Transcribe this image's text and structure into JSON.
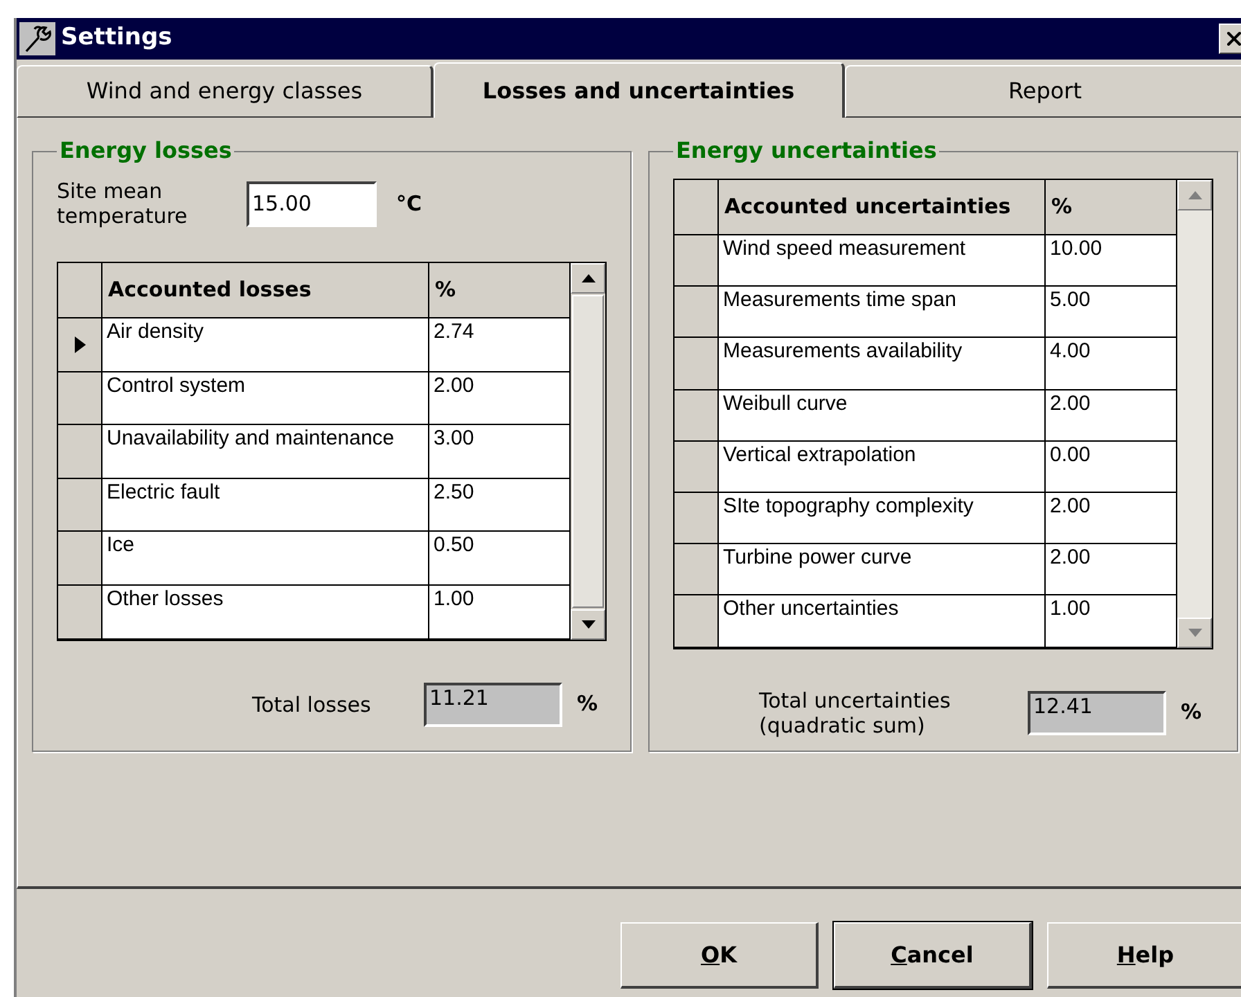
{
  "window": {
    "title": "Settings"
  },
  "tabs": [
    {
      "label": "Wind and energy classes",
      "selected": false
    },
    {
      "label": "Losses and uncertainties",
      "selected": true
    },
    {
      "label": "Report",
      "selected": false
    }
  ],
  "energy_losses": {
    "title": "Energy losses",
    "temperature": {
      "label": "Site mean temperature",
      "value": "15.00",
      "unit": "°C"
    },
    "table": {
      "columns": [
        "Accounted losses",
        "%"
      ],
      "rows": [
        {
          "name": "Air density",
          "value": "2.74",
          "selected": true
        },
        {
          "name": "Control system",
          "value": "2.00",
          "selected": false
        },
        {
          "name": "Unavailability and maintenance",
          "value": "3.00",
          "selected": false
        },
        {
          "name": "Electric fault",
          "value": "2.50",
          "selected": false
        },
        {
          "name": "Ice",
          "value": "0.50",
          "selected": false
        },
        {
          "name": "Other losses",
          "value": "1.00",
          "selected": false
        }
      ]
    },
    "total": {
      "label": "Total losses",
      "value": "11.21",
      "unit": "%"
    }
  },
  "energy_uncertainties": {
    "title": "Energy uncertainties",
    "table": {
      "columns": [
        "Accounted uncertainties",
        "%"
      ],
      "rows": [
        {
          "name": "Wind speed measurement",
          "value": "10.00",
          "selected": false
        },
        {
          "name": "Measurements time span",
          "value": "5.00",
          "selected": false
        },
        {
          "name": "Measurements availability",
          "value": "4.00",
          "selected": false
        },
        {
          "name": "Weibull curve",
          "value": "2.00",
          "selected": false
        },
        {
          "name": "Vertical extrapolation",
          "value": "0.00",
          "selected": false
        },
        {
          "name": "SIte topography complexity",
          "value": "2.00",
          "selected": false
        },
        {
          "name": "Turbine power curve",
          "value": "2.00",
          "selected": false
        },
        {
          "name": "Other uncertainties",
          "value": "1.00",
          "selected": false
        }
      ]
    },
    "total": {
      "label": "Total uncertainties (quadratic sum)",
      "value": "12.41",
      "unit": "%"
    }
  },
  "buttons": [
    {
      "label": "OK",
      "default": false
    },
    {
      "label": "Cancel",
      "default": true
    },
    {
      "label": "Help",
      "default": false
    }
  ]
}
